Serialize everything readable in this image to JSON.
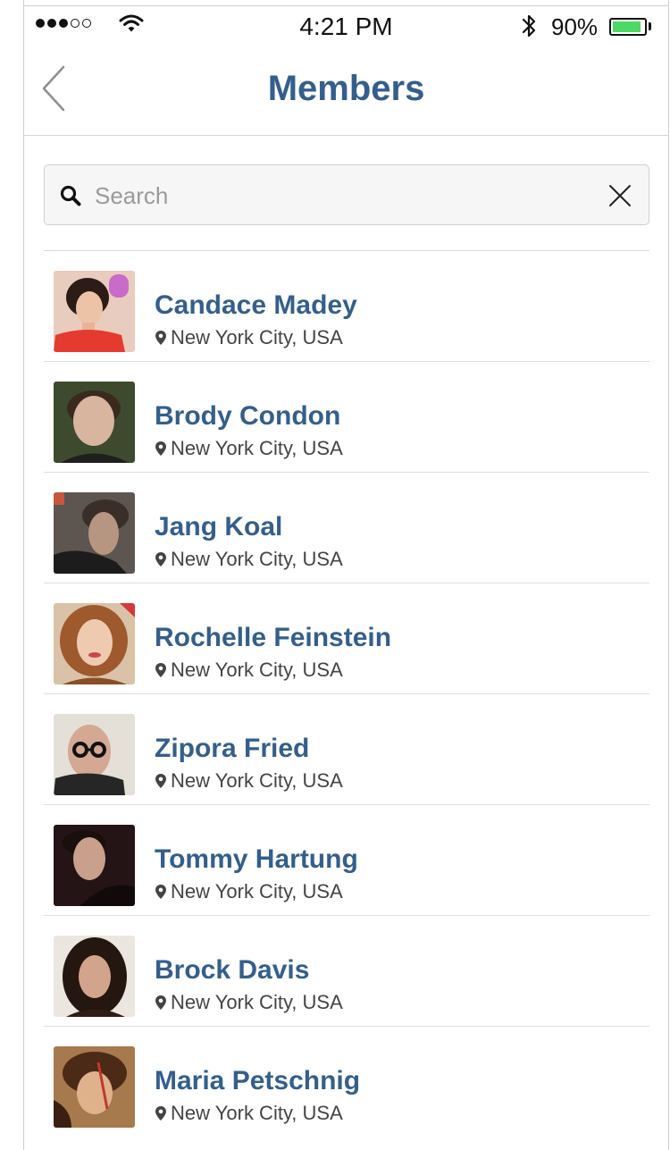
{
  "status_bar": {
    "time": "4:21 PM",
    "battery_percent": "90%",
    "battery_level": 0.9,
    "signal_bars_filled": 3,
    "signal_bars_total": 5,
    "icons": [
      "signal-dots",
      "wifi-icon",
      "bluetooth-icon",
      "battery-icon"
    ]
  },
  "nav": {
    "title": "Members",
    "back_icon": "chevron-left-icon"
  },
  "search": {
    "placeholder": "Search",
    "value": "",
    "search_icon": "magnifier-icon",
    "clear_icon": "close-icon"
  },
  "members": [
    {
      "name": "Candace Madey",
      "location": "New York City, USA",
      "avatar": "portrait-photo"
    },
    {
      "name": "Brody Condon",
      "location": "New York City, USA",
      "avatar": "portrait-photo"
    },
    {
      "name": "Jang Koal",
      "location": "New York City, USA",
      "avatar": "portrait-photo"
    },
    {
      "name": "Rochelle Feinstein",
      "location": "New York City, USA",
      "avatar": "portrait-photo"
    },
    {
      "name": "Zipora Fried",
      "location": "New York City, USA",
      "avatar": "portrait-photo"
    },
    {
      "name": "Tommy Hartung",
      "location": "New York City, USA",
      "avatar": "portrait-photo"
    },
    {
      "name": "Brock Davis",
      "location": "New York City, USA",
      "avatar": "portrait-photo"
    },
    {
      "name": "Maria Petschnig",
      "location": "New York City, USA",
      "avatar": "portrait-photo"
    }
  ],
  "colors": {
    "accent": "#345f8c",
    "battery_fill": "#4cd964",
    "divider": "#e0e0e0"
  }
}
